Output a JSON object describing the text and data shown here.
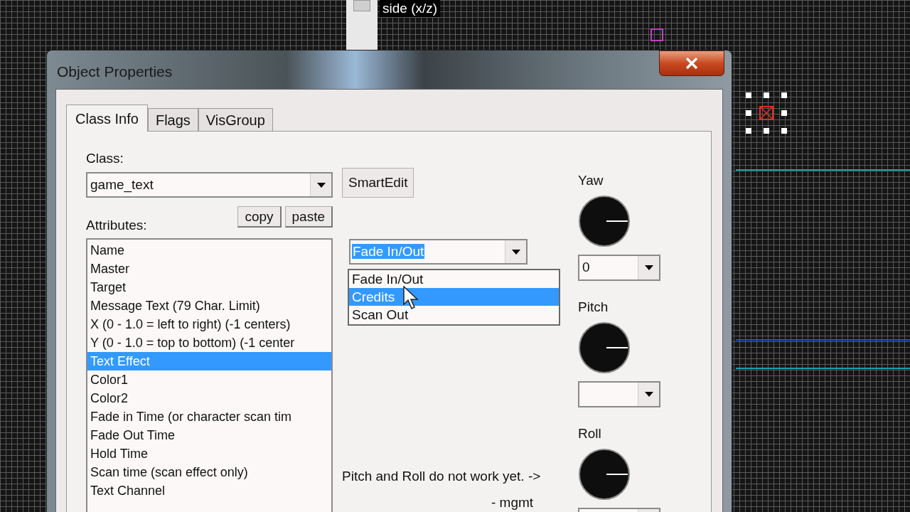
{
  "viewport_label": "side (x/z)",
  "window": {
    "title": "Object Properties"
  },
  "tabs": [
    {
      "label": "Class Info",
      "selected": true
    },
    {
      "label": "Flags",
      "selected": false
    },
    {
      "label": "VisGroup",
      "selected": false
    }
  ],
  "class_field": {
    "label": "Class:",
    "value": "game_text"
  },
  "smart_edit_button": "SmartEdit",
  "attributes": {
    "label": "Attributes:",
    "buttons": [
      "copy",
      "paste"
    ],
    "items": [
      {
        "label": "Name",
        "selected": false
      },
      {
        "label": "Master",
        "selected": false
      },
      {
        "label": "Target",
        "selected": false
      },
      {
        "label": "Message Text (79 Char. Limit)",
        "selected": false
      },
      {
        "label": "X (0 - 1.0 = left to right) (-1 centers)",
        "selected": false
      },
      {
        "label": "Y (0 - 1.0 = top to bottom) (-1 center",
        "selected": false
      },
      {
        "label": "Text Effect",
        "selected": true
      },
      {
        "label": "Color1",
        "selected": false
      },
      {
        "label": "Color2",
        "selected": false
      },
      {
        "label": "Fade in Time (or character scan tim",
        "selected": false
      },
      {
        "label": "Fade Out Time",
        "selected": false
      },
      {
        "label": "Hold Time",
        "selected": false
      },
      {
        "label": "Scan time (scan effect only)",
        "selected": false
      },
      {
        "label": "Text Channel",
        "selected": false
      }
    ]
  },
  "value_dropdown": {
    "value": "Fade In/Out",
    "expanded": true,
    "options": [
      {
        "label": "Fade In/Out",
        "highlighted": false
      },
      {
        "label": "Credits",
        "highlighted": true
      },
      {
        "label": "Scan Out",
        "highlighted": false
      }
    ]
  },
  "angles": [
    {
      "label": "Yaw",
      "value": "0"
    },
    {
      "label": "Pitch"
    },
    {
      "label": "Roll"
    }
  ],
  "note": "Pitch and Roll do not work yet. ->",
  "signature": "- mgmt"
}
